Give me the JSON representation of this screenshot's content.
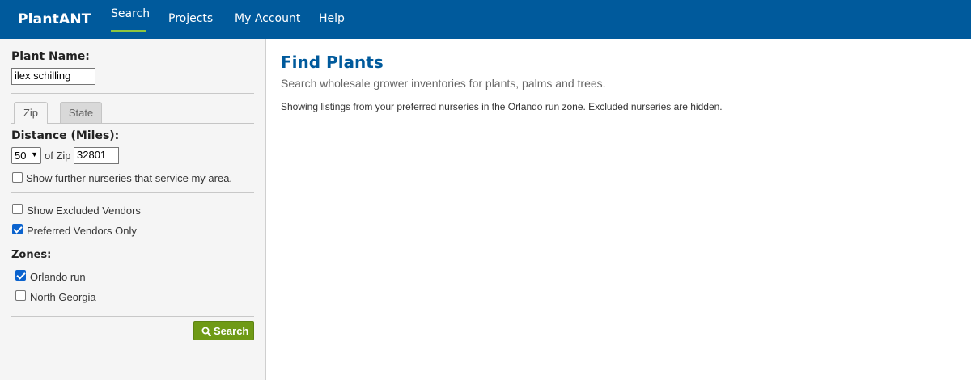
{
  "nav": {
    "brand": "PlantANT",
    "items": [
      "Search",
      "Projects",
      "My Account",
      "Help"
    ],
    "active": "Search"
  },
  "sidebar": {
    "plant_name_label": "Plant Name:",
    "plant_name_value": "ilex schilling",
    "tabs": [
      "Zip",
      "State"
    ],
    "active_tab": "Zip",
    "distance_label": "Distance (Miles):",
    "distance_value": "50",
    "of_zip_label": "of Zip",
    "zip_value": "32801",
    "further_label": "Show further nurseries that service my area.",
    "further_checked": false,
    "excluded_label": "Show Excluded Vendors",
    "excluded_checked": false,
    "preferred_label": "Preferred Vendors Only",
    "preferred_checked": true,
    "zones_label": "Zones:",
    "zones": [
      {
        "label": "Orlando run",
        "checked": true
      },
      {
        "label": "North Georgia",
        "checked": false
      }
    ],
    "search_button": "Search",
    "search_icon": "search-icon"
  },
  "main": {
    "title": "Find Plants",
    "subtitle": "Search wholesale grower inventories for plants, palms and trees.",
    "note": "Showing listings from your preferred nurseries in the Orlando run zone. Excluded nurseries are hidden."
  },
  "colors": {
    "nav_bg": "#005a9c",
    "nav_accent": "#8dc63f",
    "title": "#005a9c",
    "button": "#6f9a16",
    "checkbox": "#0b63ce"
  }
}
